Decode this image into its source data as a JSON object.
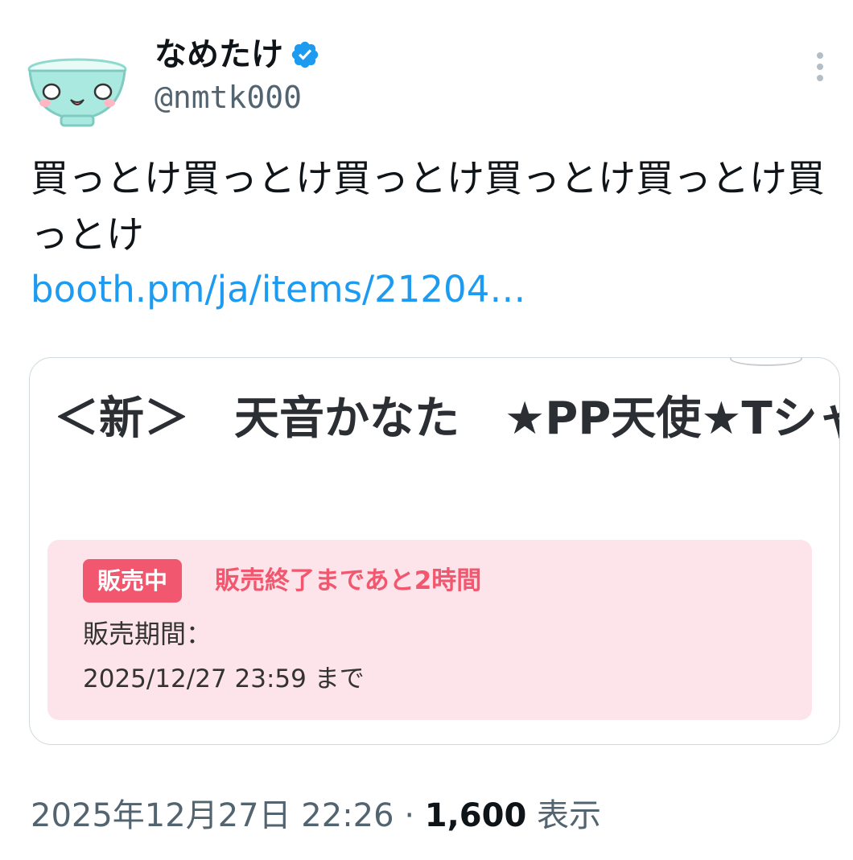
{
  "user": {
    "display_name": "なめたけ",
    "handle": "@nmtk000",
    "verified": true,
    "verified_color": "#1d9bf0"
  },
  "tweet": {
    "text": "買っとけ買っとけ買っとけ買っとけ買っとけ買っとけ",
    "link": "booth.pm/ja/items/21204…"
  },
  "card": {
    "title": "＜新＞　天音かなた　★PP天使★Tシャツ（ボイス特典付き）",
    "badge": "販売中",
    "countdown": "販売終了まであと2時間",
    "period_label": "販売期間：",
    "period_value": "2025/12/27 23:59 まで"
  },
  "footer": {
    "timestamp": "2025年12月27日 22:26",
    "separator": "·",
    "views": "1,600",
    "views_label": "表示"
  },
  "icons": {
    "avatar": "rice-bowl-face-icon",
    "verified": "verified-badge-icon",
    "more": "more-vertical-icon"
  },
  "colors": {
    "link": "#1d9bf0",
    "secondary_text": "#536471",
    "sale_accent": "#f1576e",
    "sale_background": "#fde4ea"
  }
}
